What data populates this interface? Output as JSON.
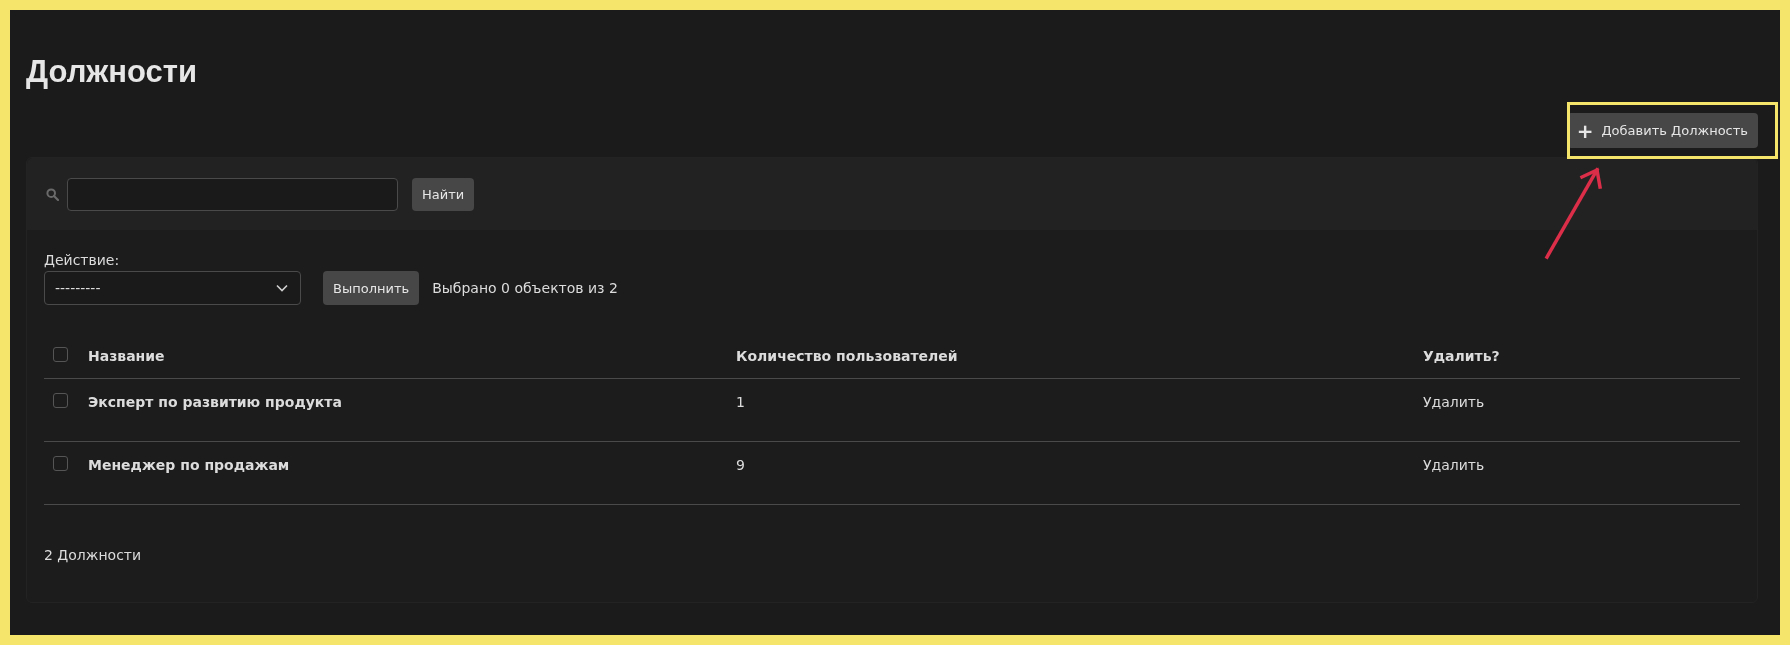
{
  "title": "Должности",
  "add_button": {
    "icon": "+",
    "label": "Добавить Должность"
  },
  "search": {
    "button": "Найти"
  },
  "actions": {
    "label": "Действие:",
    "select_value": "---------",
    "button": "Выполнить",
    "counter": "Выбрано 0 объектов из 2"
  },
  "table": {
    "select_all_checked": false,
    "columns": [
      "Название",
      "Количество пользователей",
      "Удалить?"
    ],
    "rows": [
      {
        "checked": false,
        "name": "Эксперт по развитию продукта",
        "count": "1",
        "delete": "Удалить"
      },
      {
        "checked": false,
        "name": "Менеджер по продажам",
        "count": "9",
        "delete": "Удалить"
      }
    ]
  },
  "footer": "2 Должности"
}
